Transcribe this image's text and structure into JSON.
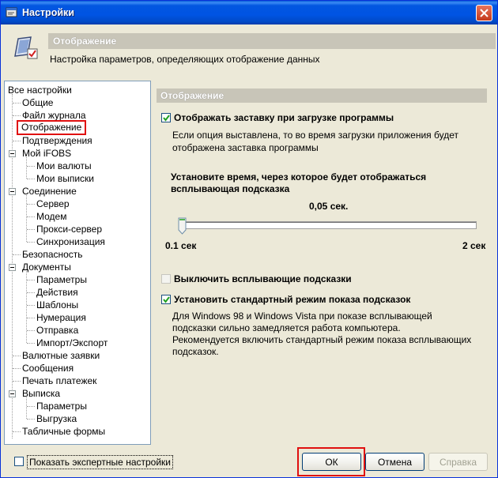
{
  "window": {
    "title": "Настройки"
  },
  "header": {
    "title": "Отображение",
    "description": "Настройка параметров, определяющих отображение данных"
  },
  "tree": {
    "items": [
      {
        "label": "Все настройки",
        "level": 0
      },
      {
        "label": "Общие",
        "level": 1
      },
      {
        "label": "Файл журнала",
        "level": 1
      },
      {
        "label": "Отображение",
        "level": 1,
        "selected": true
      },
      {
        "label": "Подтверждения",
        "level": 1
      },
      {
        "label": "Мой iFOBS",
        "level": 1,
        "expanded": true
      },
      {
        "label": "Мои валюты",
        "level": 2
      },
      {
        "label": "Мои выписки",
        "level": 2
      },
      {
        "label": "Соединение",
        "level": 1,
        "expanded": true
      },
      {
        "label": "Сервер",
        "level": 2
      },
      {
        "label": "Модем",
        "level": 2
      },
      {
        "label": "Прокси-сервер",
        "level": 2
      },
      {
        "label": "Синхронизация",
        "level": 2
      },
      {
        "label": "Безопасность",
        "level": 1
      },
      {
        "label": "Документы",
        "level": 1,
        "expanded": true
      },
      {
        "label": "Параметры",
        "level": 2
      },
      {
        "label": "Действия",
        "level": 2
      },
      {
        "label": "Шаблоны",
        "level": 2
      },
      {
        "label": "Нумерация",
        "level": 2
      },
      {
        "label": "Отправка",
        "level": 2
      },
      {
        "label": "Импорт/Экспорт",
        "level": 2
      },
      {
        "label": "Валютные заявки",
        "level": 1
      },
      {
        "label": "Сообщения",
        "level": 1
      },
      {
        "label": "Печать платежек",
        "level": 1
      },
      {
        "label": "Выписка",
        "level": 1,
        "expanded": true
      },
      {
        "label": "Параметры",
        "level": 2
      },
      {
        "label": "Выгрузка",
        "level": 2
      },
      {
        "label": "Табличные формы",
        "level": 1
      }
    ]
  },
  "panel": {
    "title": "Отображение",
    "splash": {
      "label": "Отображать заставку при загрузке программы",
      "checked": true,
      "description_line1": "Если опция выставлена, то во время загрузки приложения будет",
      "description_line2": "отображена заставка программы"
    },
    "tooltip_time": {
      "caption_line1": "Установите время, через которое будет отображаться",
      "caption_line2": "всплывающая подсказка",
      "value": "0,05 сек.",
      "min_label": "0.1 сек",
      "max_label": "2 сек"
    },
    "disable_tooltips": {
      "label": "Выключить всплывающие подсказки",
      "checked": false
    },
    "standard_tooltips": {
      "label": "Установить стандартный режим показа подсказок",
      "checked": true,
      "description_line1": "Для Windows 98 и Windows Vista при показе всплывающей",
      "description_line2": "подсказки сильно замедляется работа компьютера.",
      "description_line3": "Рекомендуется включить стандартный режим показа всплывающих",
      "description_line4": "подсказок."
    }
  },
  "footer": {
    "expert_label": "Показать экспертные настройки",
    "ok_label": "ОК",
    "cancel_label": "Отмена",
    "help_label": "Справка"
  }
}
